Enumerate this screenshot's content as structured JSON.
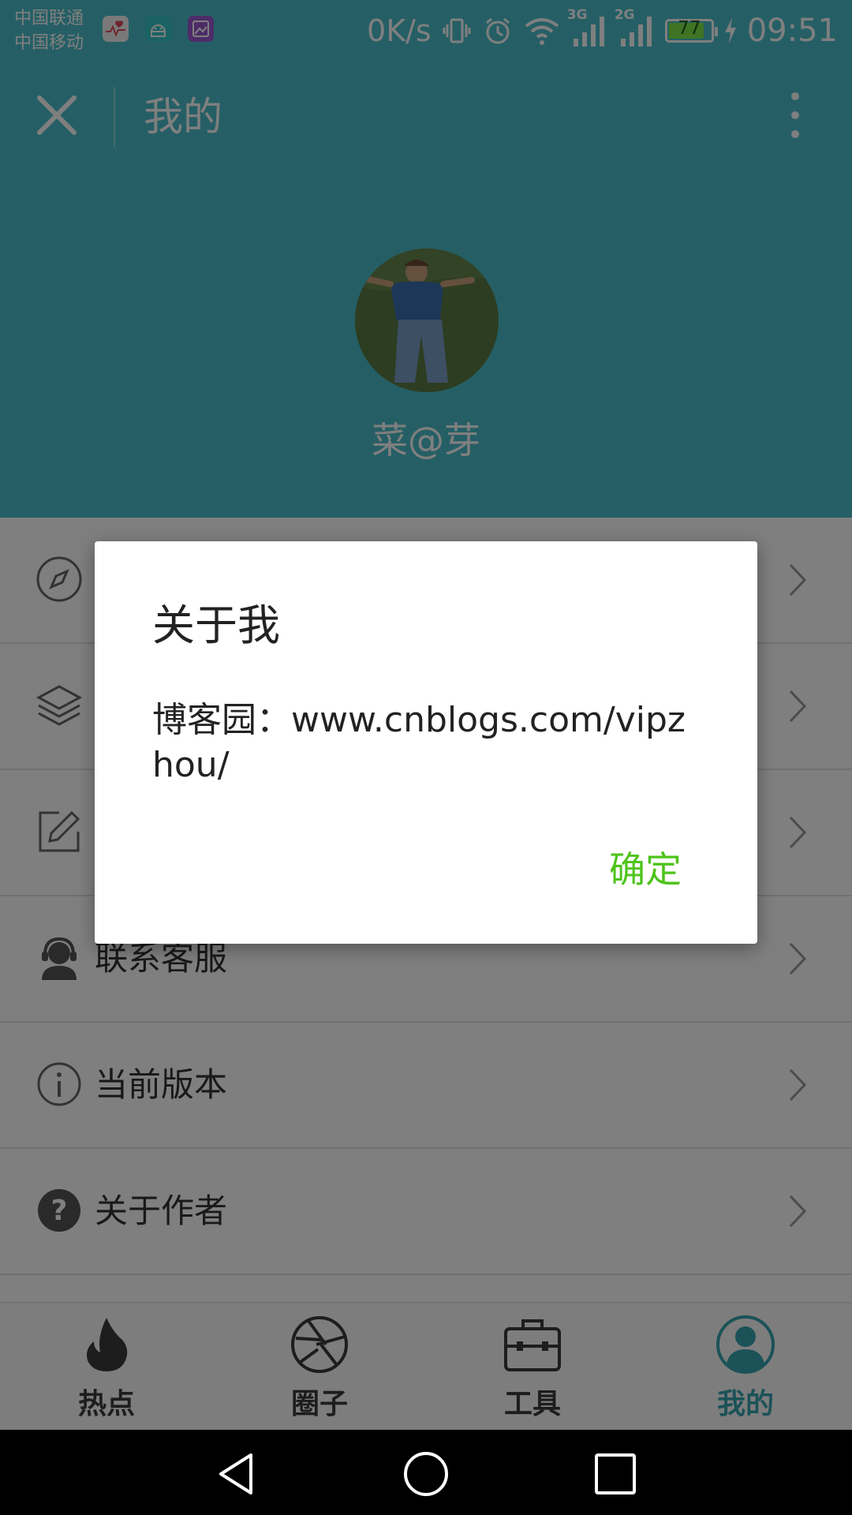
{
  "status_bar": {
    "carrier_1": "中国联通",
    "carrier_2": "中国移动",
    "net_speed": "0K/s",
    "signal_1_label": "3G",
    "signal_2_label": "2G",
    "battery_level": "77",
    "time": "09:51",
    "app_icon_colors": [
      "#f3f3f3",
      "#35c5c9",
      "#9b59d0"
    ]
  },
  "header": {
    "title": "我的",
    "username": "菜@芽",
    "background": "#4bbfcb"
  },
  "menu": {
    "items": [
      {
        "label": "",
        "icon": "compass-icon"
      },
      {
        "label": "",
        "icon": "layers-icon"
      },
      {
        "label": "",
        "icon": "edit-icon"
      },
      {
        "label": "联系客服",
        "icon": "support-agent-icon"
      },
      {
        "label": "当前版本",
        "icon": "info-icon"
      },
      {
        "label": "关于作者",
        "icon": "help-icon"
      }
    ]
  },
  "bottom_nav": {
    "items": [
      {
        "label": "热点",
        "icon": "flame-icon"
      },
      {
        "label": "圈子",
        "icon": "aperture-icon"
      },
      {
        "label": "工具",
        "icon": "toolbox-icon"
      },
      {
        "label": "我的",
        "icon": "user-icon",
        "active": true
      }
    ],
    "active_color": "#36a4b1"
  },
  "dialog": {
    "title": "关于我",
    "message": "博客园：www.cnblogs.com/vipzhou/",
    "ok_label": "确定",
    "ok_color": "#4fc41c"
  }
}
